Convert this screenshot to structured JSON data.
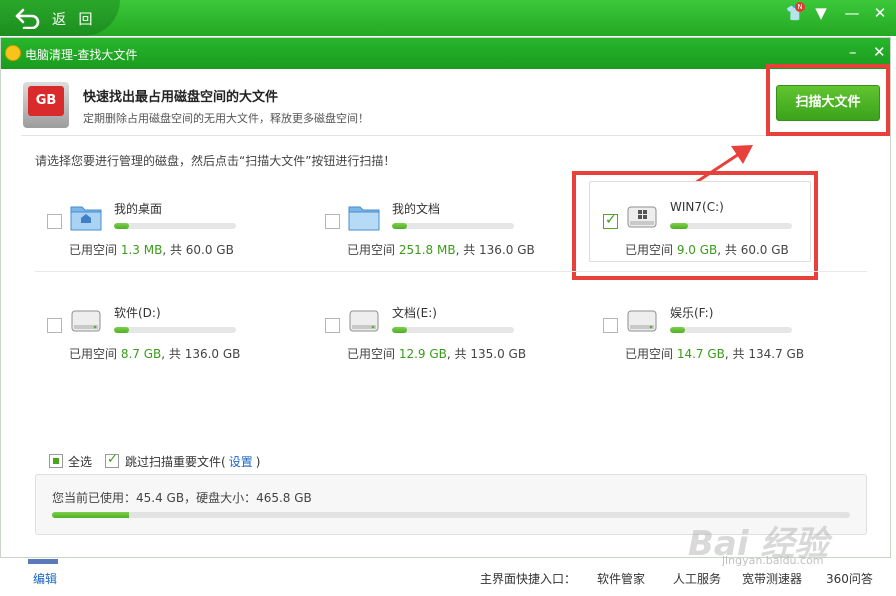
{
  "top_bar": {
    "back_label": "返 回",
    "badge": "N"
  },
  "window": {
    "title": "电脑清理-查找大文件"
  },
  "header": {
    "icon_text": "GB",
    "headline": "快速找出最占用磁盘空间的大文件",
    "subline": "定期删除占用磁盘空间的无用大文件，释放更多磁盘空间！",
    "scan_button_label": "扫描大文件"
  },
  "instruction": "请选择您要进行管理的磁盘，然后点击“扫描大文件”按钮进行扫描！",
  "disks": [
    {
      "name": "我的桌面",
      "usage_prefix": "已用空间 ",
      "used": "1.3 MB",
      "usage_suffix": ", 共 60.0 GB",
      "fill": 0.12,
      "checked": false,
      "icon": "desktop-folder-icon"
    },
    {
      "name": "我的文档",
      "usage_prefix": "已用空间 ",
      "used": "251.8 MB",
      "usage_suffix": ", 共 136.0 GB",
      "fill": 0.12,
      "checked": false,
      "icon": "documents-folder-icon"
    },
    {
      "name": "WIN7(C:)",
      "usage_prefix": "已用空间 ",
      "used": "9.0 GB",
      "usage_suffix": ", 共 60.0 GB",
      "fill": 0.15,
      "checked": true,
      "icon": "windows-drive-icon"
    },
    {
      "name": "软件(D:)",
      "usage_prefix": "已用空间 ",
      "used": "8.7 GB",
      "usage_suffix": ", 共 136.0 GB",
      "fill": 0.12,
      "checked": false,
      "icon": "drive-icon"
    },
    {
      "name": "文档(E:)",
      "usage_prefix": "已用空间 ",
      "used": "12.9 GB",
      "usage_suffix": ", 共 135.0 GB",
      "fill": 0.12,
      "checked": false,
      "icon": "drive-icon"
    },
    {
      "name": "娱乐(F:)",
      "usage_prefix": "已用空间 ",
      "used": "14.7 GB",
      "usage_suffix": ", 共 134.7 GB",
      "fill": 0.12,
      "checked": false,
      "icon": "drive-icon"
    }
  ],
  "options": {
    "select_all_label": "全选",
    "skip_label": "跳过扫描重要文件(",
    "settings_link": "设置",
    "skip_suffix": ")"
  },
  "summary": {
    "text": "您当前已使用：45.4 GB，硬盘大小：465.8 GB",
    "fill": 0.097
  },
  "footer": {
    "edit_label": "编辑",
    "shortcut_label": "主界面快捷入口：",
    "links": [
      "软件管家",
      "人工服务",
      "宽带测速器",
      "360问答"
    ]
  },
  "watermark": {
    "brand": "Bai 经验",
    "url": "jingyan.baidu.com"
  },
  "colors": {
    "brand_green": "#23a823",
    "highlight_red": "#e8403a",
    "value_green": "#3a9c1a",
    "link_blue": "#1a66c2"
  }
}
